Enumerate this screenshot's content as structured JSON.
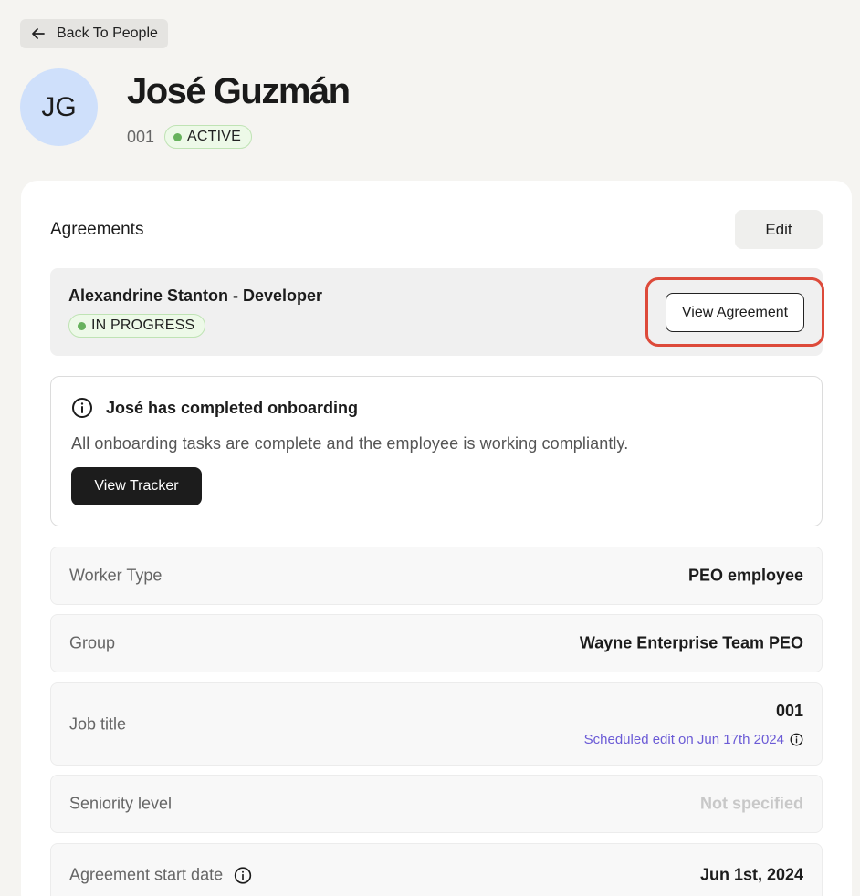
{
  "nav": {
    "back_label": "Back To People",
    "back_icon": "arrow-left-icon"
  },
  "profile": {
    "initials": "JG",
    "name": "José Guzmán",
    "employee_id": "001",
    "status": "ACTIVE",
    "status_color": "#67b25d"
  },
  "agreements": {
    "title": "Agreements",
    "edit_label": "Edit",
    "item": {
      "name": "Alexandrine Stanton - Developer",
      "status": "IN PROGRESS",
      "view_label": "View Agreement"
    },
    "highlight_color": "#dd4a3a"
  },
  "onboarding": {
    "title": "José has completed onboarding",
    "description": "All onboarding tasks are complete and the employee is working compliantly.",
    "button_label": "View Tracker"
  },
  "details": {
    "worker_type": {
      "label": "Worker Type",
      "value": "PEO employee"
    },
    "group": {
      "label": "Group",
      "value": "Wayne Enterprise Team PEO"
    },
    "job_title": {
      "label": "Job title",
      "value": "001",
      "scheduled": "Scheduled edit on Jun 17th 2024",
      "accent": "#6b5bd6"
    },
    "seniority": {
      "label": "Seniority level",
      "value": "Not specified"
    },
    "start_date": {
      "label": "Agreement start date",
      "value": "Jun 1st, 2024"
    }
  }
}
